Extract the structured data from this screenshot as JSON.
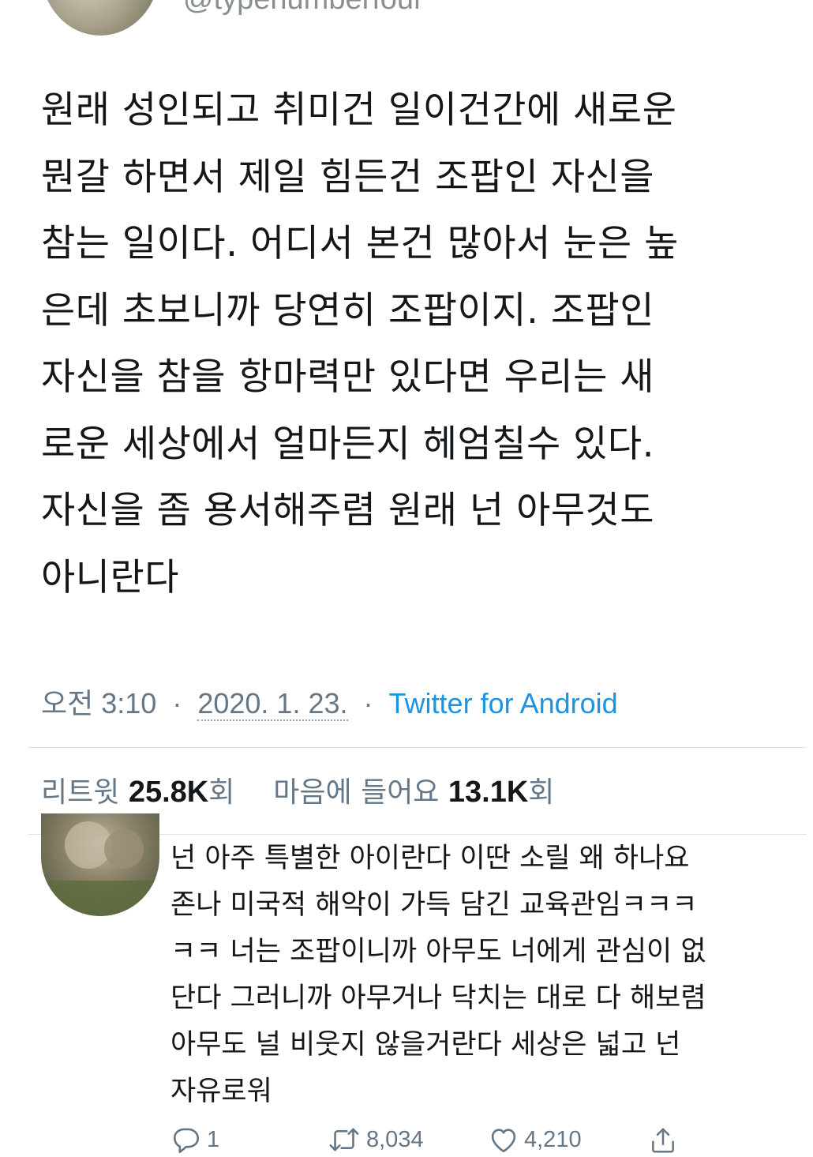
{
  "author": {
    "handle": "@typenumberfour"
  },
  "tweet": {
    "text": "원래 성인되고 취미건 일이건간에 새로운\n뭔갈 하면서 제일 힘든건 조팝인 자신을\n참는 일이다. 어디서 본건 많아서 눈은 높\n은데 초보니까 당연히 조팝이지. 조팝인\n자신을 참을 항마력만 있다면 우리는 새\n로운 세상에서 얼마든지 헤엄칠수 있다.\n자신을 좀 용서해주렴 원래 넌 아무것도\n아니란다",
    "time": "오전 3:10",
    "date": "2020. 1. 23.",
    "separator": "·",
    "source": "Twitter for Android"
  },
  "stats": {
    "retweet_label": "리트윗",
    "retweet_count": "25.8K",
    "retweet_suffix": "회",
    "like_label": "마음에 들어요",
    "like_count": "13.1K",
    "like_suffix": "회"
  },
  "reply": {
    "text": "넌 아주 특별한 아이란다 이딴 소릴 왜 하나요\n존나 미국적 해악이 가득 담긴 교육관임ㅋㅋㅋ\nㅋㅋ 너는 조팝이니까 아무도 너에게 관심이 없\n단다 그러니까 아무거나 닥치는 대로 다 해보렴\n아무도 널 비웃지 않을거란다 세상은 넓고 넌\n자유로워",
    "actions": {
      "reply_count": "1",
      "retweet_count": "8,034",
      "like_count": "4,210"
    }
  },
  "icons": {
    "reply": "reply-icon",
    "retweet": "retweet-icon",
    "like": "heart-icon",
    "share": "share-icon"
  },
  "colors": {
    "link": "#1b95e0",
    "muted": "#657786",
    "text": "#14171a"
  }
}
